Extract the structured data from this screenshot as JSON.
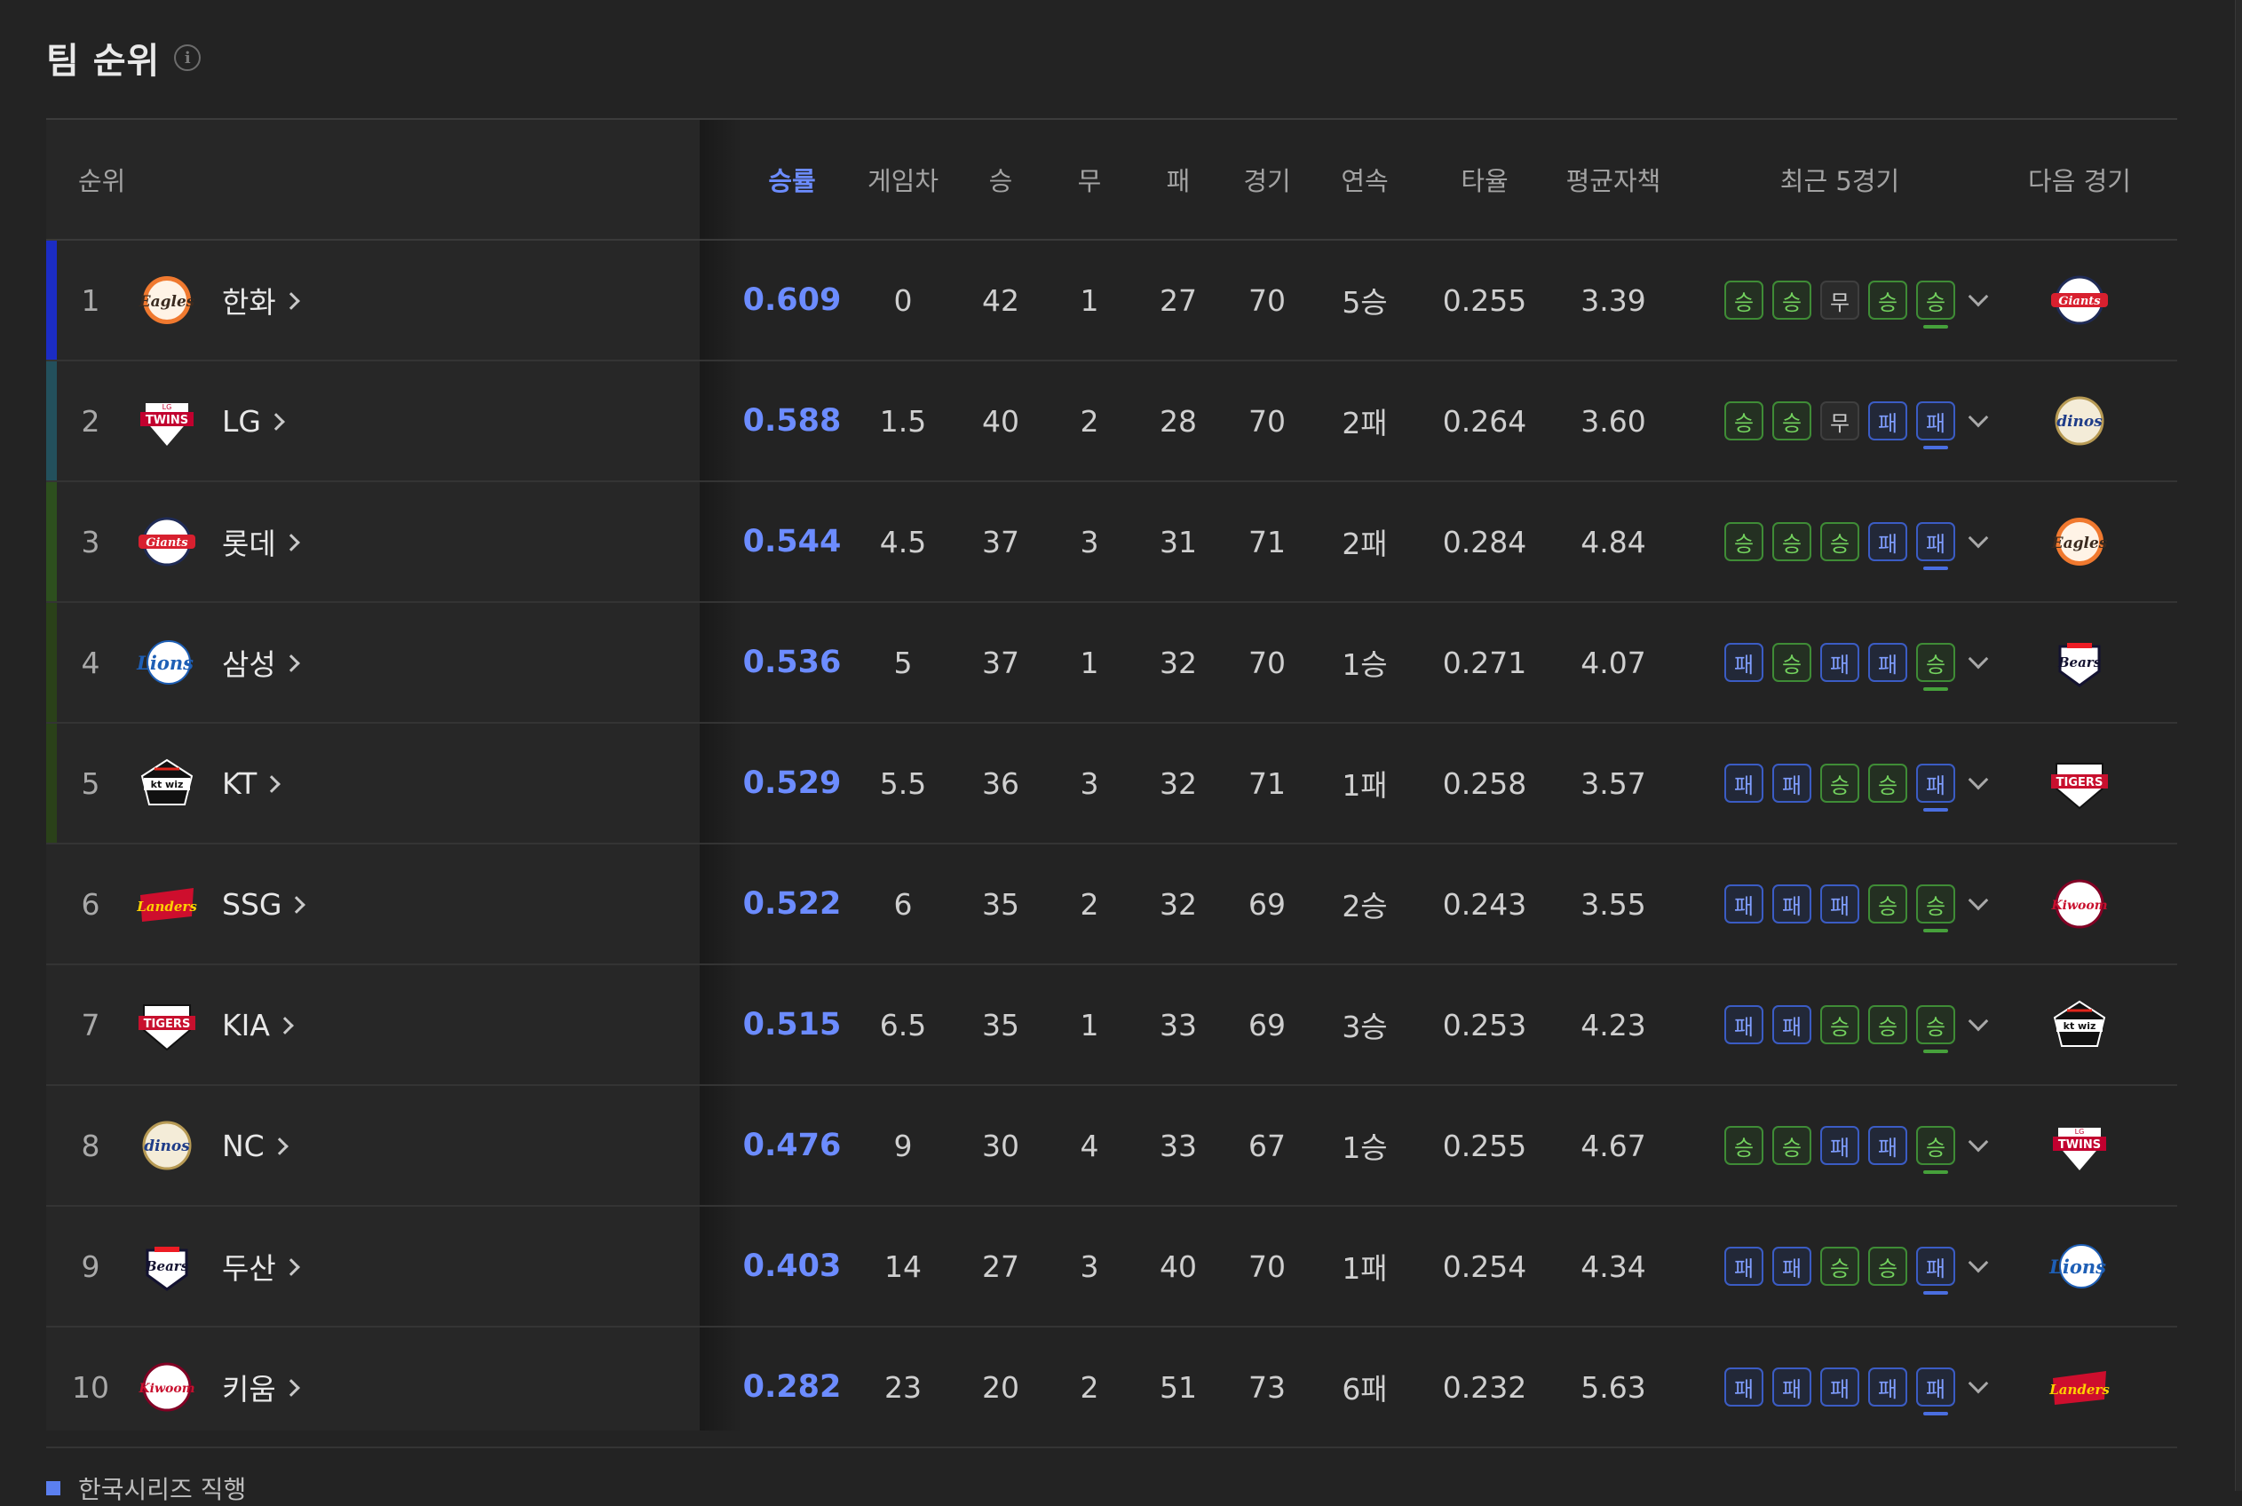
{
  "header": {
    "title": "팀 순위",
    "info_icon": "info-icon"
  },
  "columns": {
    "rank": "순위",
    "win_pct": "승률",
    "games_behind": "게임차",
    "wins": "승",
    "draws": "무",
    "losses": "패",
    "games": "경기",
    "streak": "연속",
    "batting_avg": "타율",
    "era": "평균자책",
    "recent5": "최근 5경기",
    "next_game": "다음 경기"
  },
  "colors": {
    "accent": "#6c8cff",
    "win": "#73d25e",
    "loss": "#7f9dff",
    "bar_top": "#1b2cc4",
    "bar_second": "#23505c",
    "bar_playoff": "#2b4a1f"
  },
  "rows": [
    {
      "rank": "1",
      "team": "한화",
      "logo": "eagles",
      "win_pct": "0.609",
      "gb": "0",
      "w": "42",
      "d": "1",
      "l": "27",
      "g": "70",
      "streak": "5승",
      "avg": "0.255",
      "era": "3.39",
      "recent": [
        "승",
        "승",
        "무",
        "승",
        "승"
      ],
      "next_logo": "giants",
      "bar": "#1b2cc4"
    },
    {
      "rank": "2",
      "team": "LG",
      "logo": "twins",
      "win_pct": "0.588",
      "gb": "1.5",
      "w": "40",
      "d": "2",
      "l": "28",
      "g": "70",
      "streak": "2패",
      "avg": "0.264",
      "era": "3.60",
      "recent": [
        "승",
        "승",
        "무",
        "패",
        "패"
      ],
      "next_logo": "dinos",
      "bar": "#23505c"
    },
    {
      "rank": "3",
      "team": "롯데",
      "logo": "giants",
      "win_pct": "0.544",
      "gb": "4.5",
      "w": "37",
      "d": "3",
      "l": "31",
      "g": "71",
      "streak": "2패",
      "avg": "0.284",
      "era": "4.84",
      "recent": [
        "승",
        "승",
        "승",
        "패",
        "패"
      ],
      "next_logo": "eagles",
      "bar": "#2d4f1e"
    },
    {
      "rank": "4",
      "team": "삼성",
      "logo": "lions",
      "win_pct": "0.536",
      "gb": "5",
      "w": "37",
      "d": "1",
      "l": "32",
      "g": "70",
      "streak": "1승",
      "avg": "0.271",
      "era": "4.07",
      "recent": [
        "패",
        "승",
        "패",
        "패",
        "승"
      ],
      "next_logo": "bears",
      "bar": "#2a4119"
    },
    {
      "rank": "5",
      "team": "KT",
      "logo": "ktwiz",
      "win_pct": "0.529",
      "gb": "5.5",
      "w": "36",
      "d": "3",
      "l": "32",
      "g": "71",
      "streak": "1패",
      "avg": "0.258",
      "era": "3.57",
      "recent": [
        "패",
        "패",
        "승",
        "승",
        "패"
      ],
      "next_logo": "tigers",
      "bar": "#2a4119"
    },
    {
      "rank": "6",
      "team": "SSG",
      "logo": "landers",
      "win_pct": "0.522",
      "gb": "6",
      "w": "35",
      "d": "2",
      "l": "32",
      "g": "69",
      "streak": "2승",
      "avg": "0.243",
      "era": "3.55",
      "recent": [
        "패",
        "패",
        "패",
        "승",
        "승"
      ],
      "next_logo": "kiwoom",
      "bar": ""
    },
    {
      "rank": "7",
      "team": "KIA",
      "logo": "tigers",
      "win_pct": "0.515",
      "gb": "6.5",
      "w": "35",
      "d": "1",
      "l": "33",
      "g": "69",
      "streak": "3승",
      "avg": "0.253",
      "era": "4.23",
      "recent": [
        "패",
        "패",
        "승",
        "승",
        "승"
      ],
      "next_logo": "ktwiz",
      "bar": ""
    },
    {
      "rank": "8",
      "team": "NC",
      "logo": "dinos",
      "win_pct": "0.476",
      "gb": "9",
      "w": "30",
      "d": "4",
      "l": "33",
      "g": "67",
      "streak": "1승",
      "avg": "0.255",
      "era": "4.67",
      "recent": [
        "승",
        "승",
        "패",
        "패",
        "승"
      ],
      "next_logo": "twins",
      "bar": ""
    },
    {
      "rank": "9",
      "team": "두산",
      "logo": "bears",
      "win_pct": "0.403",
      "gb": "14",
      "w": "27",
      "d": "3",
      "l": "40",
      "g": "70",
      "streak": "1패",
      "avg": "0.254",
      "era": "4.34",
      "recent": [
        "패",
        "패",
        "승",
        "승",
        "패"
      ],
      "next_logo": "lions",
      "bar": ""
    },
    {
      "rank": "10",
      "team": "키움",
      "logo": "kiwoom",
      "win_pct": "0.282",
      "gb": "23",
      "w": "20",
      "d": "2",
      "l": "51",
      "g": "73",
      "streak": "6패",
      "avg": "0.232",
      "era": "5.63",
      "recent": [
        "패",
        "패",
        "패",
        "패",
        "패"
      ],
      "next_logo": "landers",
      "bar": ""
    }
  ],
  "legend": {
    "label": "한국시리즈 직행",
    "color": "#5b7ff0"
  }
}
